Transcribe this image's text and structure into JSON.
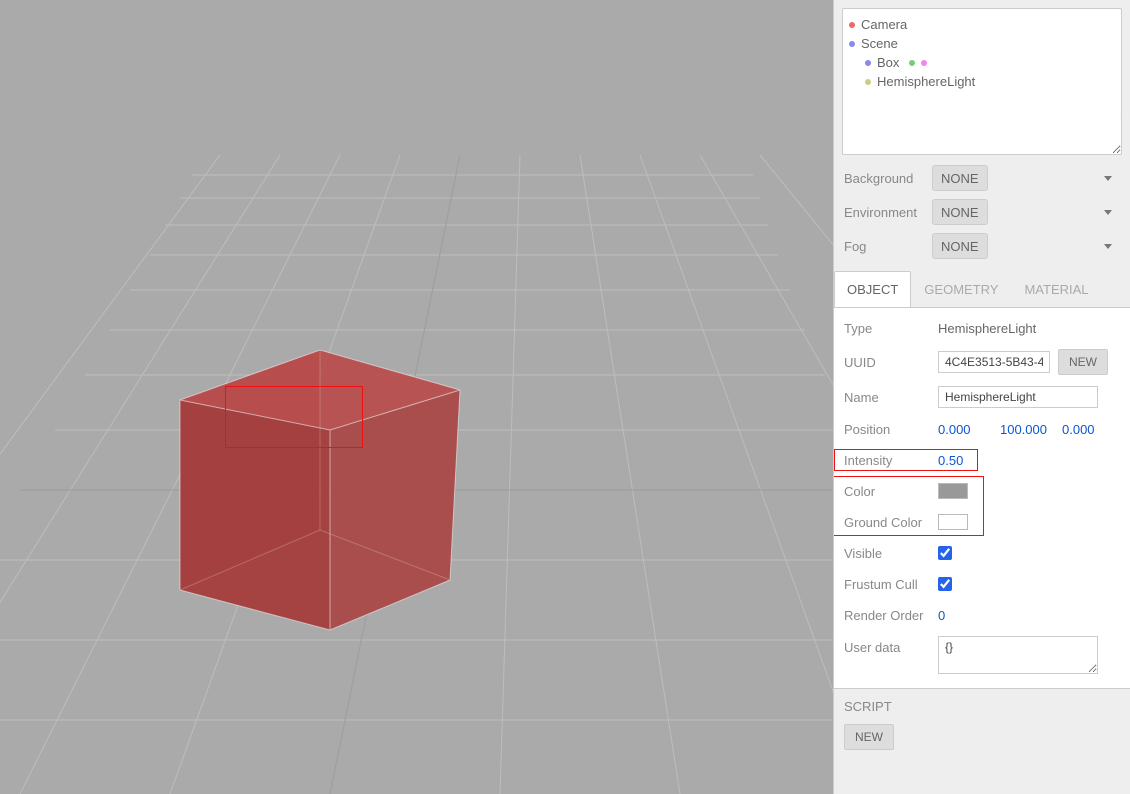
{
  "outliner": {
    "camera": {
      "label": "Camera",
      "dot": "#e66"
    },
    "scene": {
      "label": "Scene",
      "dot": "#88e"
    },
    "box": {
      "label": "Box",
      "dot": "#88e",
      "geomDot": "#7c7",
      "matDot": "#e8e"
    },
    "hemi": {
      "label": "HemisphereLight",
      "dot": "#cc8"
    }
  },
  "dropdowns": {
    "background_label": "Background",
    "environment_label": "Environment",
    "fog_label": "Fog",
    "none": "NONE"
  },
  "tabs": {
    "object": "OBJECT",
    "geometry": "GEOMETRY",
    "material": "MATERIAL"
  },
  "object": {
    "type_label": "Type",
    "type_value": "HemisphereLight",
    "uuid_label": "UUID",
    "uuid_value": "4C4E3513-5B43-4",
    "new_btn": "NEW",
    "name_label": "Name",
    "name_value": "HemisphereLight",
    "position_label": "Position",
    "position_x": "0.000",
    "position_y": "100.000",
    "position_z": "0.000",
    "intensity_label": "Intensity",
    "intensity_value": "0.50",
    "color_label": "Color",
    "color_value": "#999999",
    "ground_label": "Ground Color",
    "ground_value": "#ffffff",
    "visible_label": "Visible",
    "frustum_label": "Frustum Cull",
    "render_order_label": "Render Order",
    "render_order_value": "0",
    "userdata_label": "User data",
    "userdata_value": "{}"
  },
  "script": {
    "header": "SCRIPT",
    "new_btn": "NEW"
  }
}
